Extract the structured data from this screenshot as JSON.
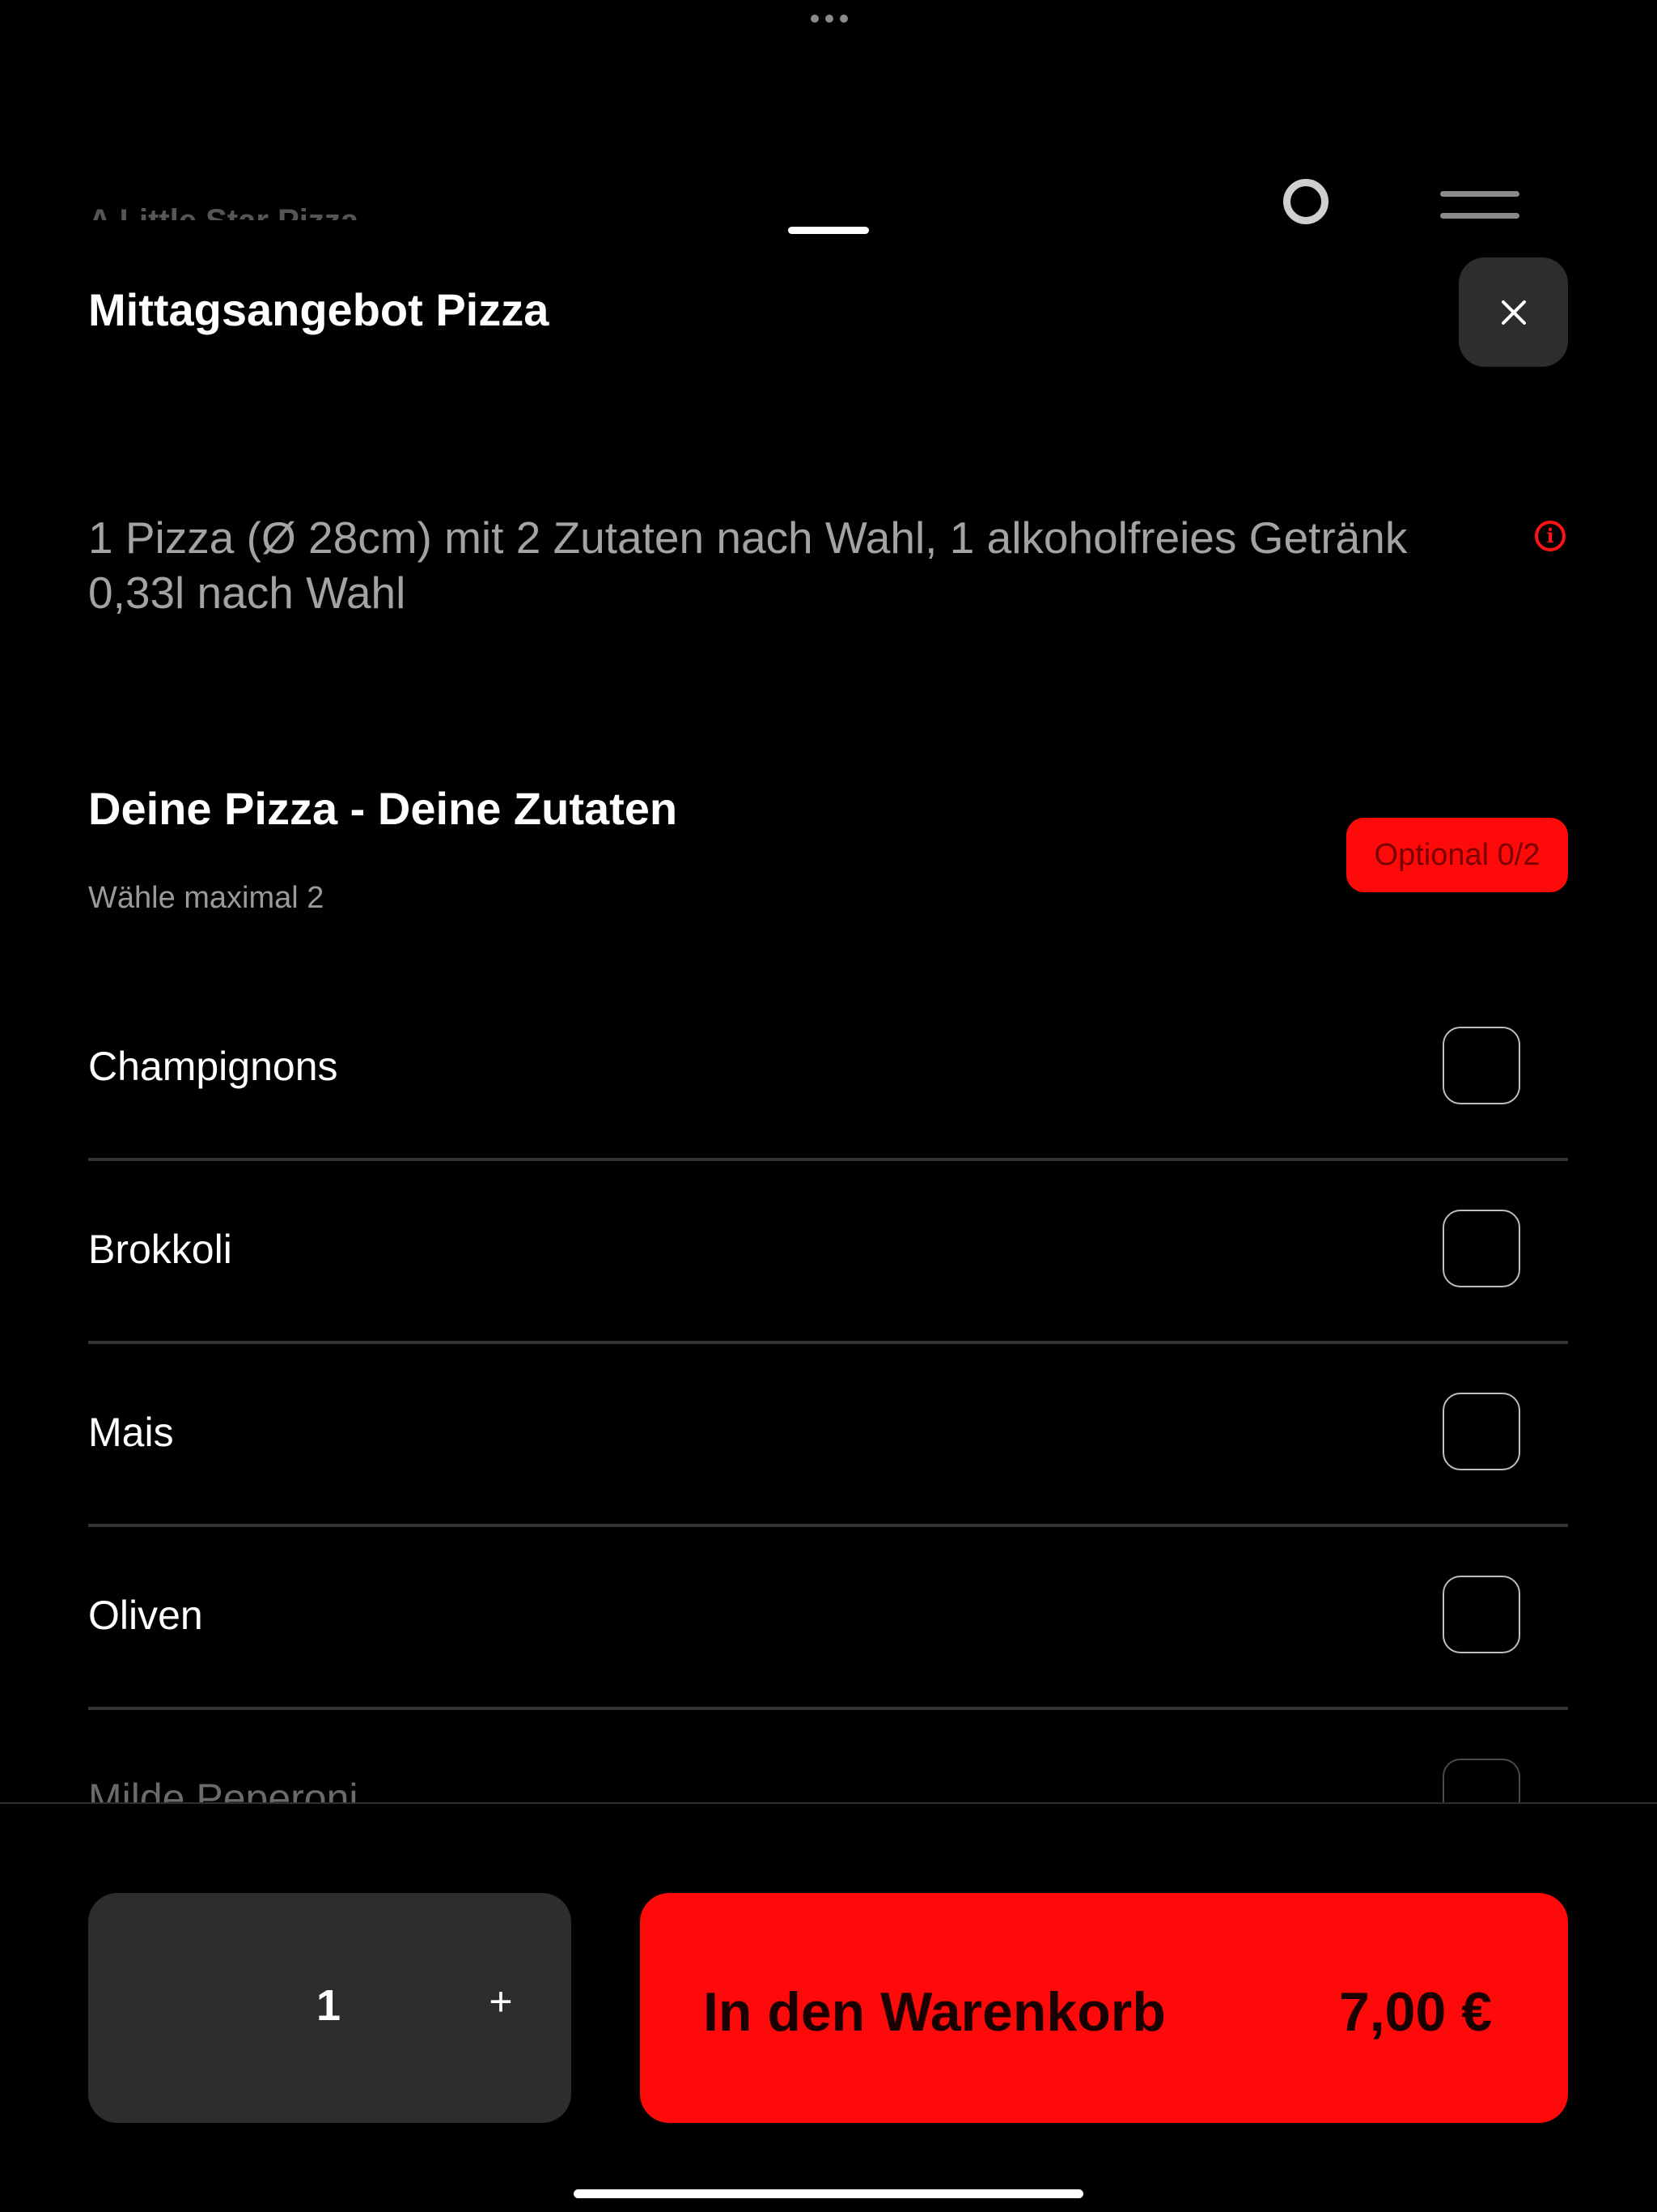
{
  "background": {
    "restaurant_name": "A Little Star Pizza"
  },
  "sheet": {
    "title": "Mittagsangebot Pizza",
    "close_label": "×",
    "description": "1 Pizza (Ø 28cm) mit 2 Zutaten nach Wahl, 1 alkoholfreies Getränk 0,33l nach Wahl",
    "info_label": "i"
  },
  "section": {
    "title": "Deine Pizza - Deine Zutaten",
    "subtitle": "Wähle maximal 2",
    "badge": "Optional 0/2",
    "items": [
      {
        "label": "Champignons",
        "checked": false
      },
      {
        "label": "Brokkoli",
        "checked": false
      },
      {
        "label": "Mais",
        "checked": false
      },
      {
        "label": "Oliven",
        "checked": false
      },
      {
        "label": "Milde Peperoni",
        "checked": false
      }
    ]
  },
  "footer": {
    "quantity": "1",
    "plus_label": "+",
    "add_to_cart_label": "In den Warenkorb",
    "price": "7,00 €"
  },
  "colors": {
    "accent": "#ff0a0a",
    "surface": "#2d2d2d",
    "background": "#000000"
  }
}
